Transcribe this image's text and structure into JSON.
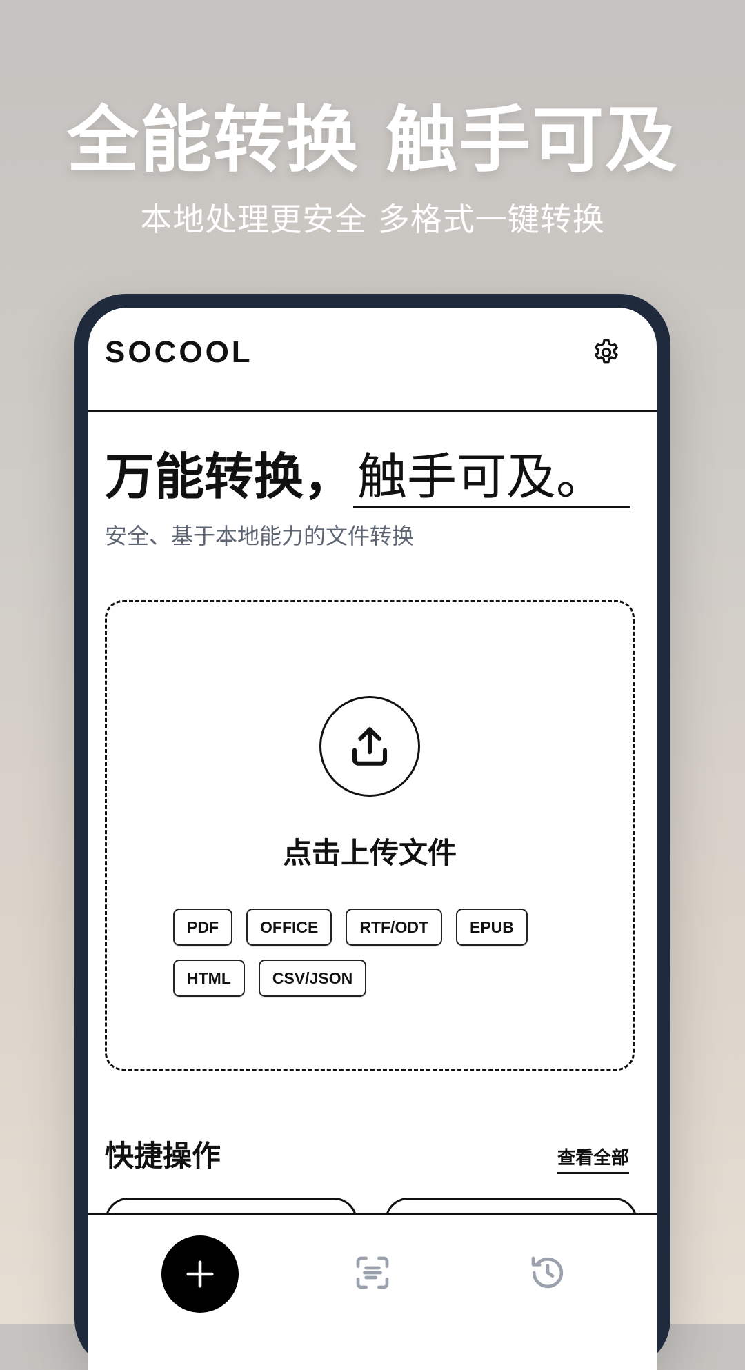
{
  "promo": {
    "title": "全能转换 触手可及",
    "subtitle": "本地处理更安全 多格式一键转换"
  },
  "header": {
    "brand": "SOCOOL",
    "settings_icon": "gear-icon"
  },
  "hero": {
    "headline_bold": "万能转换，",
    "headline_serif": "触手可及。",
    "subtitle": "安全、基于本地能力的文件转换"
  },
  "upload": {
    "icon": "upload-icon",
    "label": "点击上传文件",
    "formats": [
      "PDF",
      "OFFICE",
      "RTF/ODT",
      "EPUB",
      "HTML",
      "CSV/JSON"
    ]
  },
  "quick_actions": {
    "title": "快捷操作",
    "view_all": "查看全部"
  },
  "tabbar": {
    "add_icon": "plus-icon",
    "scan_icon": "scan-icon",
    "history_icon": "history-icon"
  },
  "colors": {
    "phone_frame": "#1f2a3c",
    "text_primary": "#111111",
    "text_secondary": "#5d6472",
    "tab_inactive": "#9aa1ad"
  }
}
